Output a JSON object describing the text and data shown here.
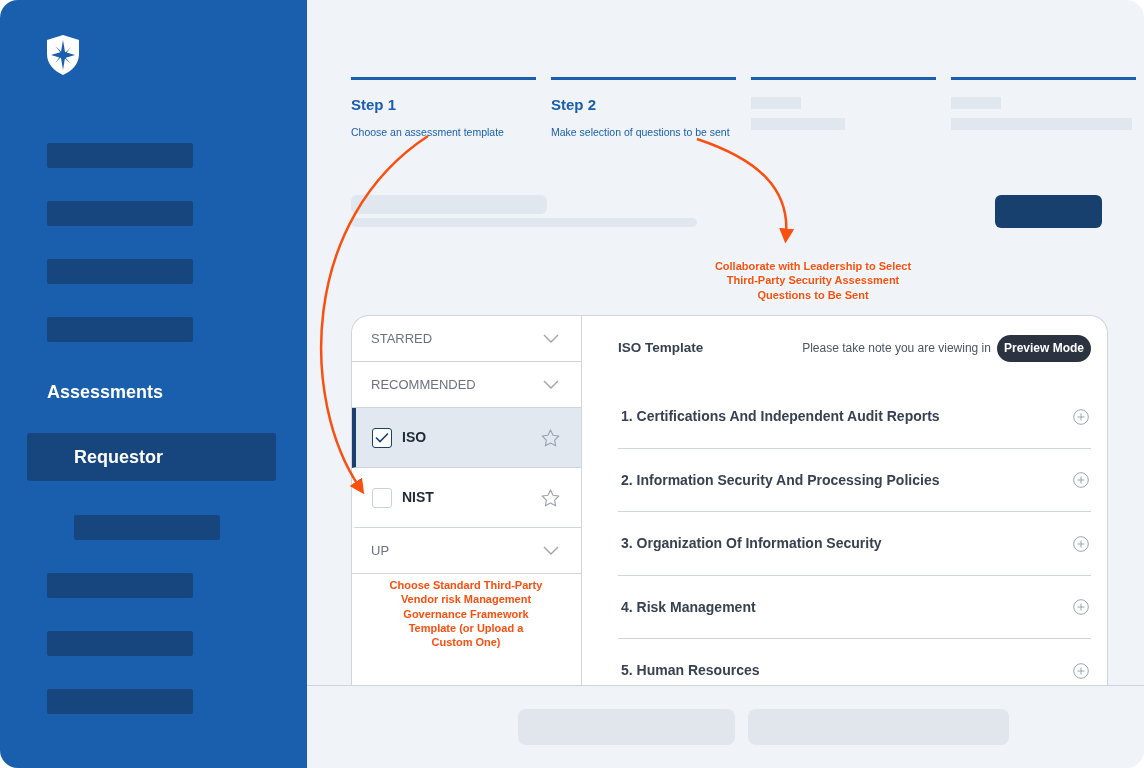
{
  "sidebar": {
    "section": "Assessments",
    "items": [
      {
        "label": "Requestor",
        "selected": true
      }
    ]
  },
  "steps": [
    {
      "title": "Step 1",
      "subtitle": "Choose an assessment template"
    },
    {
      "title": "Step 2",
      "subtitle": "Make selection of questions to be sent"
    }
  ],
  "template_list": [
    {
      "kind": "group",
      "label": "STARRED"
    },
    {
      "kind": "group",
      "label": "RECOMMENDED"
    },
    {
      "kind": "template",
      "label": "ISO",
      "checked": true,
      "selected": true,
      "starred": false
    },
    {
      "kind": "template",
      "label": "NIST",
      "checked": false,
      "selected": false,
      "starred": false
    },
    {
      "kind": "group",
      "label": "UP"
    }
  ],
  "content": {
    "title": "ISO Template",
    "notice": "Please take note you are viewing in",
    "mode_badge": "Preview Mode",
    "sections": [
      {
        "label": "1. Certifications And Independent Audit Reports",
        "expanded": false
      },
      {
        "label": "2. Information Security And Processing Policies",
        "expanded": false
      },
      {
        "label": "3. Organization Of Information Security",
        "expanded": false
      },
      {
        "label": "4. Risk Management",
        "expanded": false
      },
      {
        "label": "5. Human Resources",
        "expanded": false
      }
    ]
  },
  "annotations": [
    {
      "text": "Choose Standard Third-Party Vendor risk Management Governance Framework Template (or Upload a Custom One)"
    },
    {
      "text": "Collaborate with Leadership to Select Third-Party Security Assessment Questions to Be Sent"
    }
  ]
}
